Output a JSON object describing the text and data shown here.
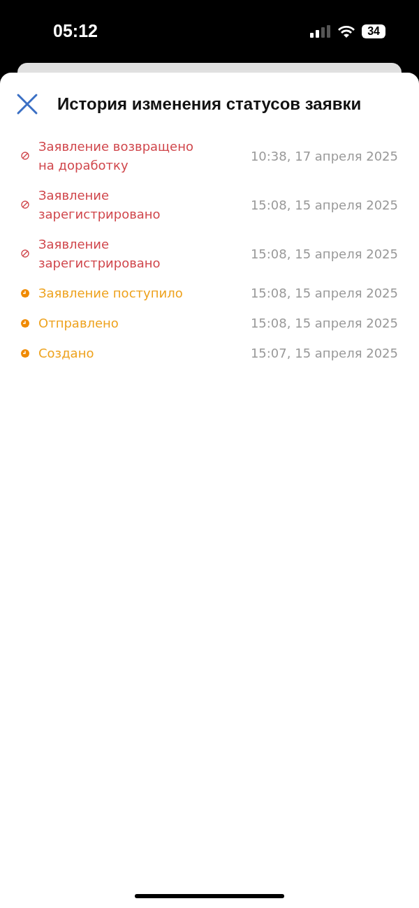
{
  "status_bar": {
    "time": "05:12",
    "battery": "34"
  },
  "sheet": {
    "title": "История изменения статусов заявки"
  },
  "history": [
    {
      "kind": "returned",
      "status": "Заявление возвращено на доработку",
      "date": "10:38, 17 апреля 2025"
    },
    {
      "kind": "returned",
      "status": "Заявление зарегистрировано",
      "date": "15:08, 15 апреля 2025"
    },
    {
      "kind": "returned",
      "status": "Заявление зарегистрировано",
      "date": "15:08, 15 апреля 2025"
    },
    {
      "kind": "pending",
      "status": "Заявление поступило",
      "date": "15:08, 15 апреля 2025"
    },
    {
      "kind": "pending",
      "status": "Отправлено",
      "date": "15:08, 15 апреля 2025"
    },
    {
      "kind": "pending",
      "status": "Создано",
      "date": "15:07, 15 апреля 2025"
    }
  ]
}
